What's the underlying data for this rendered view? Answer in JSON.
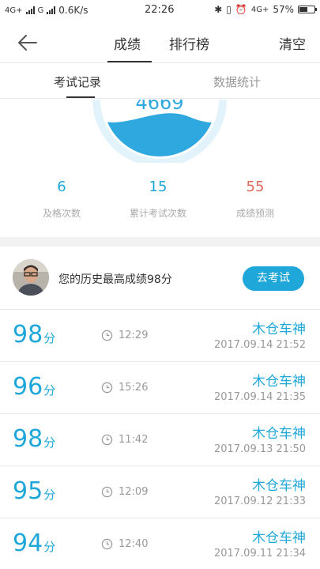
{
  "status_bar": {
    "net1": "4G+",
    "net2": "G",
    "speed": "0.6K/s",
    "time": "22:26",
    "net3": "4G+",
    "battery": "57%",
    "battery_level": 0.57
  },
  "header": {
    "tab_score": "成绩",
    "tab_rank": "排行榜",
    "clear": "清空"
  },
  "subtabs": {
    "records": "考试记录",
    "stats": "数据统计"
  },
  "gauge": {
    "value": "4669",
    "fill_color": "#2fa8e0",
    "ring_color": "#e3f3fb"
  },
  "stats": [
    {
      "value": "6",
      "label": "及格次数",
      "color": "#1fa7d9"
    },
    {
      "value": "15",
      "label": "累计考试次数",
      "color": "#1fa7d9"
    },
    {
      "value": "55",
      "label": "成绩预测",
      "color": "#e06a5a"
    }
  ],
  "best": {
    "text": "您的历史最高成绩98分",
    "button": "去考试"
  },
  "records": [
    {
      "score": "98",
      "unit": "分",
      "duration": "12:29",
      "name": "木仓车神",
      "datetime": "2017.09.14  21:52"
    },
    {
      "score": "96",
      "unit": "分",
      "duration": "15:26",
      "name": "木仓车神",
      "datetime": "2017.09.14  21:35"
    },
    {
      "score": "98",
      "unit": "分",
      "duration": "11:42",
      "name": "木仓车神",
      "datetime": "2017.09.13  21:50"
    },
    {
      "score": "95",
      "unit": "分",
      "duration": "12:09",
      "name": "木仓车神",
      "datetime": "2017.09.12  21:33"
    },
    {
      "score": "94",
      "unit": "分",
      "duration": "12:40",
      "name": "木仓车神",
      "datetime": "2017.09.11  21:34"
    }
  ]
}
